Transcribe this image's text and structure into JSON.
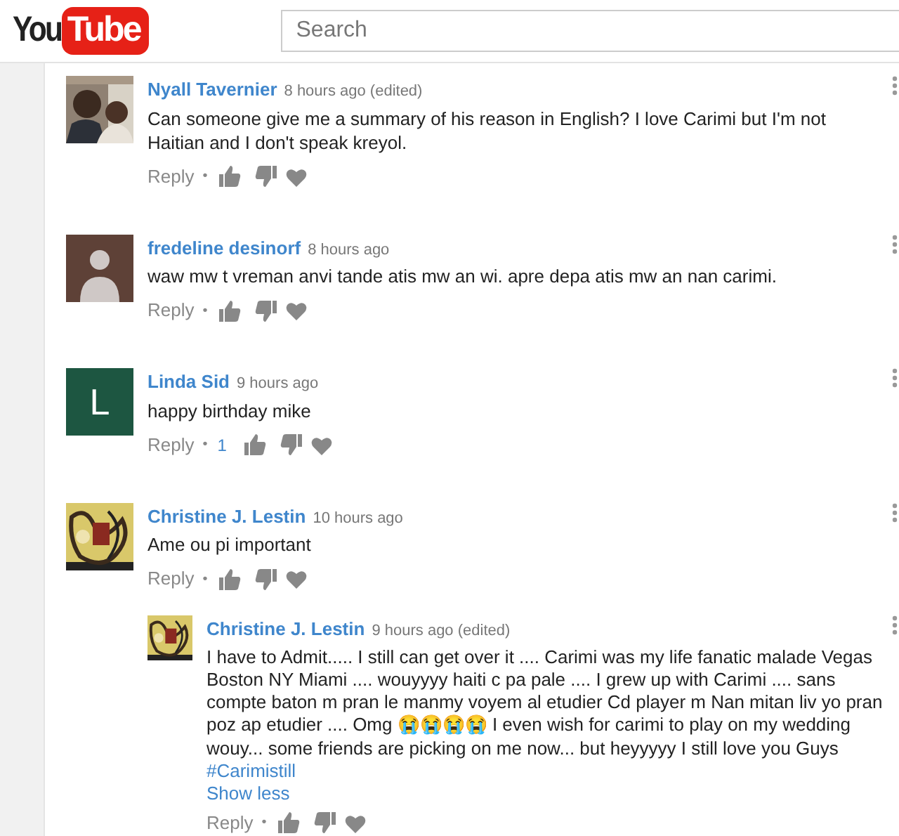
{
  "header": {
    "logo": {
      "left": "You",
      "right": "Tube"
    },
    "search": {
      "placeholder": "Search"
    }
  },
  "comments": [
    {
      "author": "Nyall Tavernier",
      "time": "8 hours ago (edited)",
      "separator": "•",
      "text": "Can someone give me a summary of his reason in English? I love Carimi but I'm not Haitian and I don't speak kreyol.",
      "reply": "Reply"
    },
    {
      "author": "fredeline desinorf",
      "time": "8 hours ago",
      "avatar": {
        "kind": "silhouette"
      },
      "separator": "•",
      "text": "waw mw t vreman anvi tande atis mw an wi. apre depa atis mw an nan carimi.",
      "reply": "Reply"
    },
    {
      "author": "Linda Sid",
      "time": "9 hours ago",
      "avatar": {
        "kind": "letter",
        "letter": "L",
        "color": "#1d5641"
      },
      "separator": "•",
      "text": "happy birthday  mike",
      "reply": "Reply",
      "likes": "1"
    },
    {
      "author": "Christine J. Lestin",
      "time": "10 hours ago",
      "separator": "•",
      "text": "Ame ou pi important",
      "reply": "Reply",
      "replies": [
        {
          "author": "Christine J. Lestin",
          "time": "9 hours ago (edited)",
          "separator": "•",
          "text": "I have to Admit..... I still can get over it .... Carimi was my life fanatic malade Vegas Boston NY Miami .... wouyyyy haiti c pa pale .... I grew up with Carimi .... sans compte baton m pran le manmy voyem al etudier Cd player m Nan mitan liv yo pran poz ap etudier .... Omg 😭😭😭😭  I even wish for carimi to play on my wedding wouy... some friends are picking on me now... but heyyyyy I still love you Guys",
          "hashtag": "#Carimistill",
          "toggle": "Show less",
          "reply": "Reply"
        }
      ]
    }
  ]
}
